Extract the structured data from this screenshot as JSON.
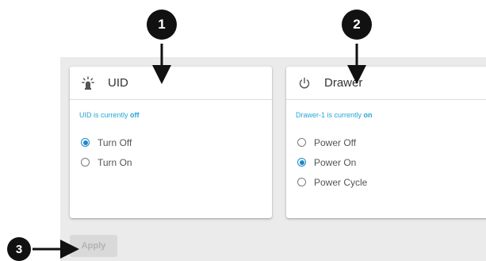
{
  "callouts": [
    "1",
    "2",
    "3"
  ],
  "uid_card": {
    "title": "UID",
    "icon": "beacon-light-icon",
    "status_prefix": "UID is currently ",
    "status_value": "off",
    "options": [
      {
        "label": "Turn Off",
        "checked": true
      },
      {
        "label": "Turn On",
        "checked": false
      }
    ]
  },
  "drawer_card": {
    "title": "Drawer",
    "icon": "power-icon",
    "status_prefix": "Drawer-1 is currently ",
    "status_value": "on",
    "options": [
      {
        "label": "Power Off",
        "checked": false
      },
      {
        "label": "Power On",
        "checked": true
      },
      {
        "label": "Power Cycle",
        "checked": false
      }
    ]
  },
  "apply_label": "Apply",
  "colors": {
    "accent": "#1e88c9",
    "status_text": "#26a5d6",
    "panel_background": "#ebebeb",
    "disabled_button": "#d9d9d9"
  }
}
